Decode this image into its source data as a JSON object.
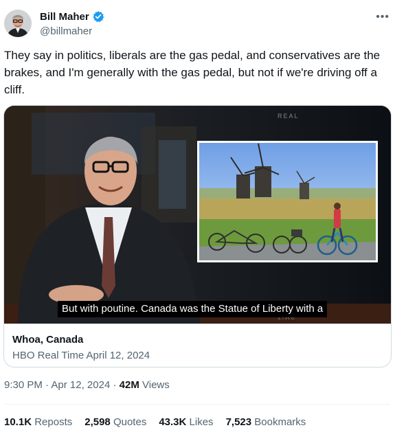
{
  "author": {
    "display_name": "Bill Maher",
    "handle": "@billmaher",
    "verified_icon": "verified-badge-icon",
    "avatar_icon": "avatar"
  },
  "more_icon": "more-horizontal-icon",
  "tweet": {
    "text": "They say in politics, liberals are the gas pedal, and conservatives are the brakes, and I'm generally with the gas pedal, but not if we're driving off a cliff."
  },
  "video": {
    "caption": "But with poutine. Canada was the Statue of Liberty with a",
    "watermark_top": "REAL",
    "watermark_bottom": "TIME"
  },
  "card": {
    "title": "Whoa, Canada",
    "subtitle": "HBO Real Time April 12, 2024"
  },
  "meta": {
    "time": "9:30 PM",
    "separator": "·",
    "date": "Apr 12, 2024",
    "views_count": "42M",
    "views_label": "Views"
  },
  "stats": {
    "reposts": {
      "count": "10.1K",
      "label": "Reposts"
    },
    "quotes": {
      "count": "2,598",
      "label": "Quotes"
    },
    "likes": {
      "count": "43.3K",
      "label": "Likes"
    },
    "bookmarks": {
      "count": "7,523",
      "label": "Bookmarks"
    }
  },
  "colors": {
    "verified": "#1d9bf0",
    "secondary_text": "#536471",
    "primary_text": "#0f1419",
    "border": "#cfd9de"
  }
}
